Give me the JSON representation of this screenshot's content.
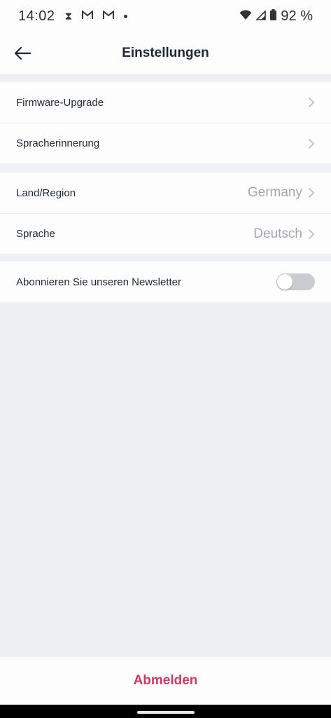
{
  "status_bar": {
    "time": "14:02",
    "notification_icons": [
      "hourglass-icon",
      "gmail-icon",
      "gmail-icon",
      "dot-icon"
    ],
    "battery": "92 %"
  },
  "header": {
    "title": "Einstellungen"
  },
  "groups": [
    {
      "items": [
        {
          "label": "Firmware-Upgrade"
        },
        {
          "label": "Spracherinnerung"
        }
      ]
    },
    {
      "items": [
        {
          "label": "Land/Region",
          "value": "Germany"
        },
        {
          "label": "Sprache",
          "value": "Deutsch"
        }
      ]
    },
    {
      "items": [
        {
          "label": "Abonnieren Sie unseren Newsletter",
          "toggle": false
        }
      ]
    }
  ],
  "footer": {
    "logout_label": "Abmelden"
  },
  "colors": {
    "accent": "#d13a5f",
    "background": "#eef0f4",
    "card": "#fdfdfd",
    "muted_text": "#a3a7ad",
    "toggle_off": "#c9cbcf"
  }
}
